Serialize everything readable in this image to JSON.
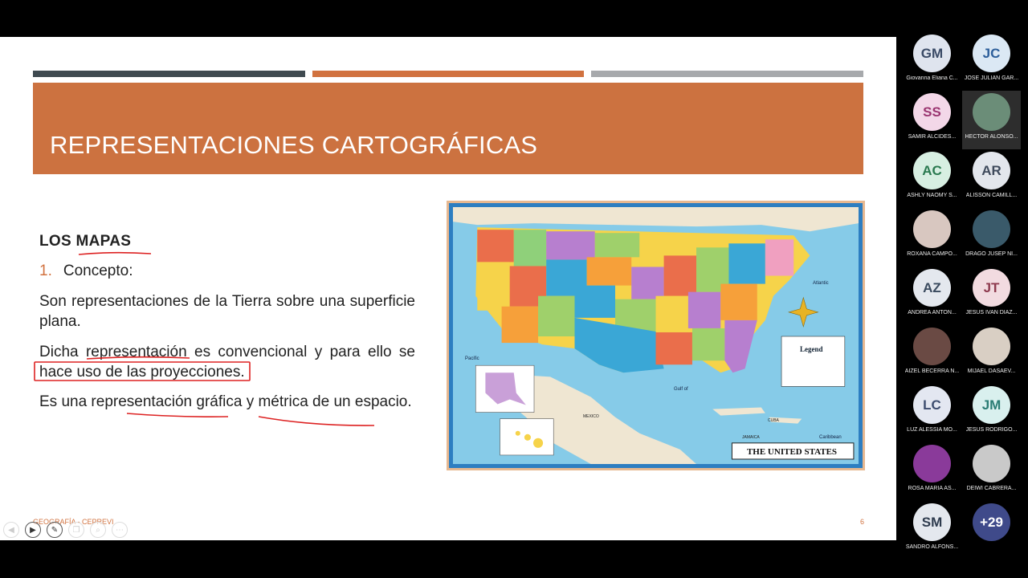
{
  "slide": {
    "title": "REPRESENTACIONES CARTOGRÁFICAS",
    "section_heading": "LOS MAPAS",
    "list_number": "1.",
    "list_item": "Concepto:",
    "paragraph1": "Son representaciones de la Tierra sobre una superficie plana.",
    "paragraph2": "Dicha representación es convencional y para ello se hace uso de las proyecciones.",
    "paragraph3": "Es una representación gráfica y métrica de un espacio.",
    "footer": "GEOGRAFÍA - CEPREVI",
    "page_number": "6"
  },
  "map": {
    "banner": "THE UNITED STATES",
    "legend_title": "Legend",
    "ocean_labels": [
      "Pacific",
      "Atlantic",
      "Gulf of",
      "Caribbean"
    ],
    "country_labels": [
      "MEXICO",
      "CUBA",
      "JAMAICA"
    ]
  },
  "slide_controls": [
    "prev-icon",
    "next-icon",
    "pen-icon",
    "copy-icon",
    "zoom-icon",
    "more-icon"
  ],
  "participants": [
    {
      "initials": "GM",
      "name": "Giovanna Eliana C...",
      "color": "#dfe4ee",
      "text_color": "#3a4a66"
    },
    {
      "initials": "JC",
      "name": "JOSE JULIAN GAR...",
      "color": "#dbe8f4",
      "text_color": "#2c5e9a"
    },
    {
      "initials": "SS",
      "name": "SAMIR ALCIDES...",
      "color": "#f3d7e8",
      "text_color": "#9a3470"
    },
    {
      "initials": "",
      "name": "HECTOR ALONSO...",
      "color": "#6b8d78",
      "text_color": "#fff",
      "photo": true
    },
    {
      "initials": "AC",
      "name": "ASHLY NAOMY S...",
      "color": "#d7efe2",
      "text_color": "#2a7a50"
    },
    {
      "initials": "AR",
      "name": "ALISSON CAMILL...",
      "color": "#e3e6ec",
      "text_color": "#3f4a5c"
    },
    {
      "initials": "",
      "name": "ROXANA CAMPO...",
      "color": "#d8c7c0",
      "text_color": "#fff",
      "photo": true
    },
    {
      "initials": "",
      "name": "DRAGO JUSEP NI...",
      "color": "#3a5a6a",
      "text_color": "#fff",
      "photo": true
    },
    {
      "initials": "AZ",
      "name": "ANDREA ANTON...",
      "color": "#e4e8ee",
      "text_color": "#3a4a5e"
    },
    {
      "initials": "JT",
      "name": "JESÚS IVAN DIAZ...",
      "color": "#f2dbe0",
      "text_color": "#8e3a4e"
    },
    {
      "initials": "",
      "name": "AIZEL BECERRA N...",
      "color": "#6a4a44",
      "text_color": "#fff",
      "photo": true
    },
    {
      "initials": "",
      "name": "MIJAEL DASAEV...",
      "color": "#d9cfc4",
      "text_color": "#fff",
      "photo": true
    },
    {
      "initials": "LC",
      "name": "LUZ ALESSIA MO...",
      "color": "#e3e7f1",
      "text_color": "#3c4c6e"
    },
    {
      "initials": "JM",
      "name": "JESUS RODRIGO...",
      "color": "#d9f0ee",
      "text_color": "#2a7c74"
    },
    {
      "initials": "",
      "name": "ROSA MARIA AS...",
      "color": "#8a3a9a",
      "text_color": "#fff",
      "photo": true
    },
    {
      "initials": "",
      "name": "DEIWI CABRERA...",
      "color": "#c9c9c9",
      "text_color": "#fff",
      "photo": true
    },
    {
      "initials": "SM",
      "name": "SANDRO ALFONS...",
      "color": "#e4e8ee",
      "text_color": "#2e3b4e"
    },
    {
      "initials": "+29",
      "name": "",
      "color": "#3f4a8a",
      "text_color": "#fff"
    }
  ]
}
